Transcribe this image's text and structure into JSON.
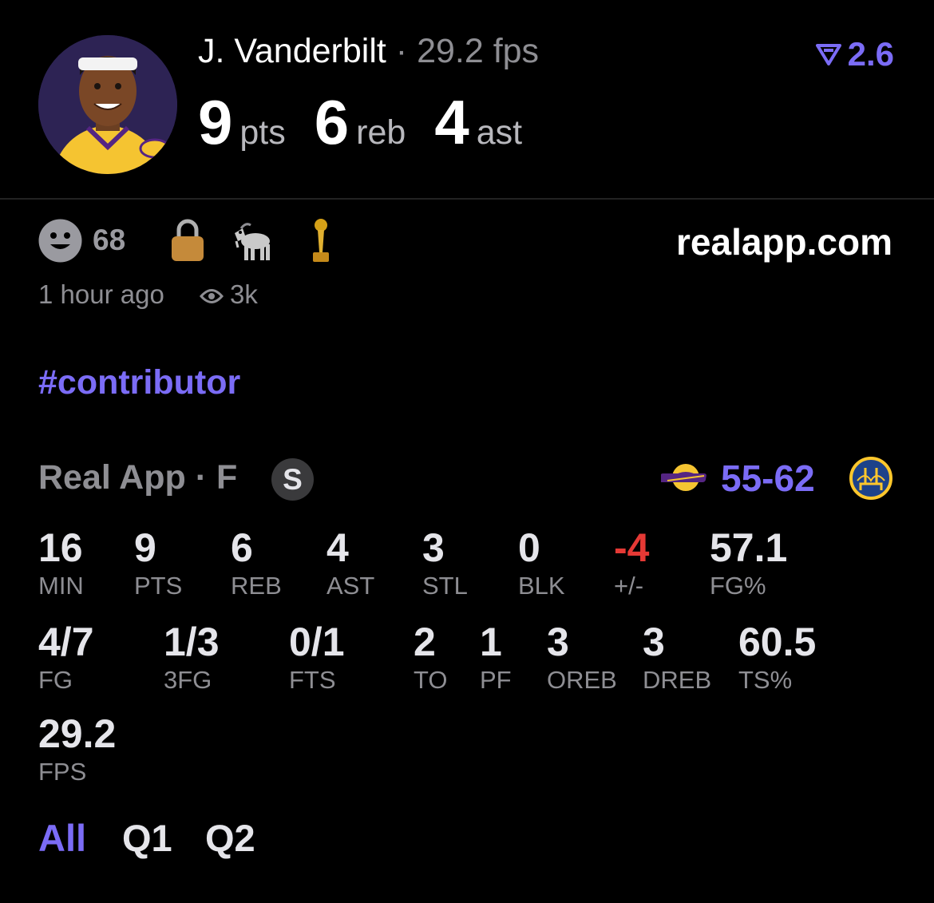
{
  "header": {
    "player_name": "J. Vanderbilt",
    "separator": "·",
    "fps_text": "29.2 fps",
    "rating": "2.6",
    "headline": [
      {
        "value": "9",
        "unit": "pts"
      },
      {
        "value": "6",
        "unit": "reb"
      },
      {
        "value": "4",
        "unit": "ast"
      }
    ]
  },
  "meta": {
    "reaction_count": "68",
    "site": "realapp.com",
    "time_ago": "1 hour ago",
    "views": "3k",
    "hashtag": "#contributor"
  },
  "game": {
    "label": "Real App · F",
    "badge": "S",
    "score_left": "55",
    "score_dash": "-",
    "score_right": "62"
  },
  "stats": [
    {
      "value": "16",
      "label": "MIN"
    },
    {
      "value": "9",
      "label": "PTS"
    },
    {
      "value": "6",
      "label": "REB"
    },
    {
      "value": "4",
      "label": "AST"
    },
    {
      "value": "3",
      "label": "STL"
    },
    {
      "value": "0",
      "label": "BLK"
    },
    {
      "value": "-4",
      "label": "+/-"
    },
    {
      "value": "57.1",
      "label": "FG%"
    },
    {
      "value": "4/7",
      "label": "FG"
    },
    {
      "value": "1/3",
      "label": "3FG"
    },
    {
      "value": "0/1",
      "label": "FTS"
    },
    {
      "value": "2",
      "label": "TO"
    },
    {
      "value": "1",
      "label": "PF"
    },
    {
      "value": "3",
      "label": "OREB"
    },
    {
      "value": "3",
      "label": "DREB"
    },
    {
      "value": "60.5",
      "label": "TS%"
    },
    {
      "value": "29.2",
      "label": "FPS"
    }
  ],
  "tabs": [
    {
      "label": "All",
      "active": true
    },
    {
      "label": "Q1",
      "active": false
    },
    {
      "label": "Q2",
      "active": false
    }
  ],
  "colors": {
    "accent": "#7b6cf6",
    "negative": "#e53935",
    "muted": "#8e8e93",
    "background": "#000000"
  },
  "icons": [
    "player-avatar",
    "rating-icon",
    "smiley-icon",
    "lock-icon",
    "goat-icon",
    "trophy-icon",
    "eye-icon",
    "lakers-logo-icon",
    "warriors-logo-icon"
  ]
}
